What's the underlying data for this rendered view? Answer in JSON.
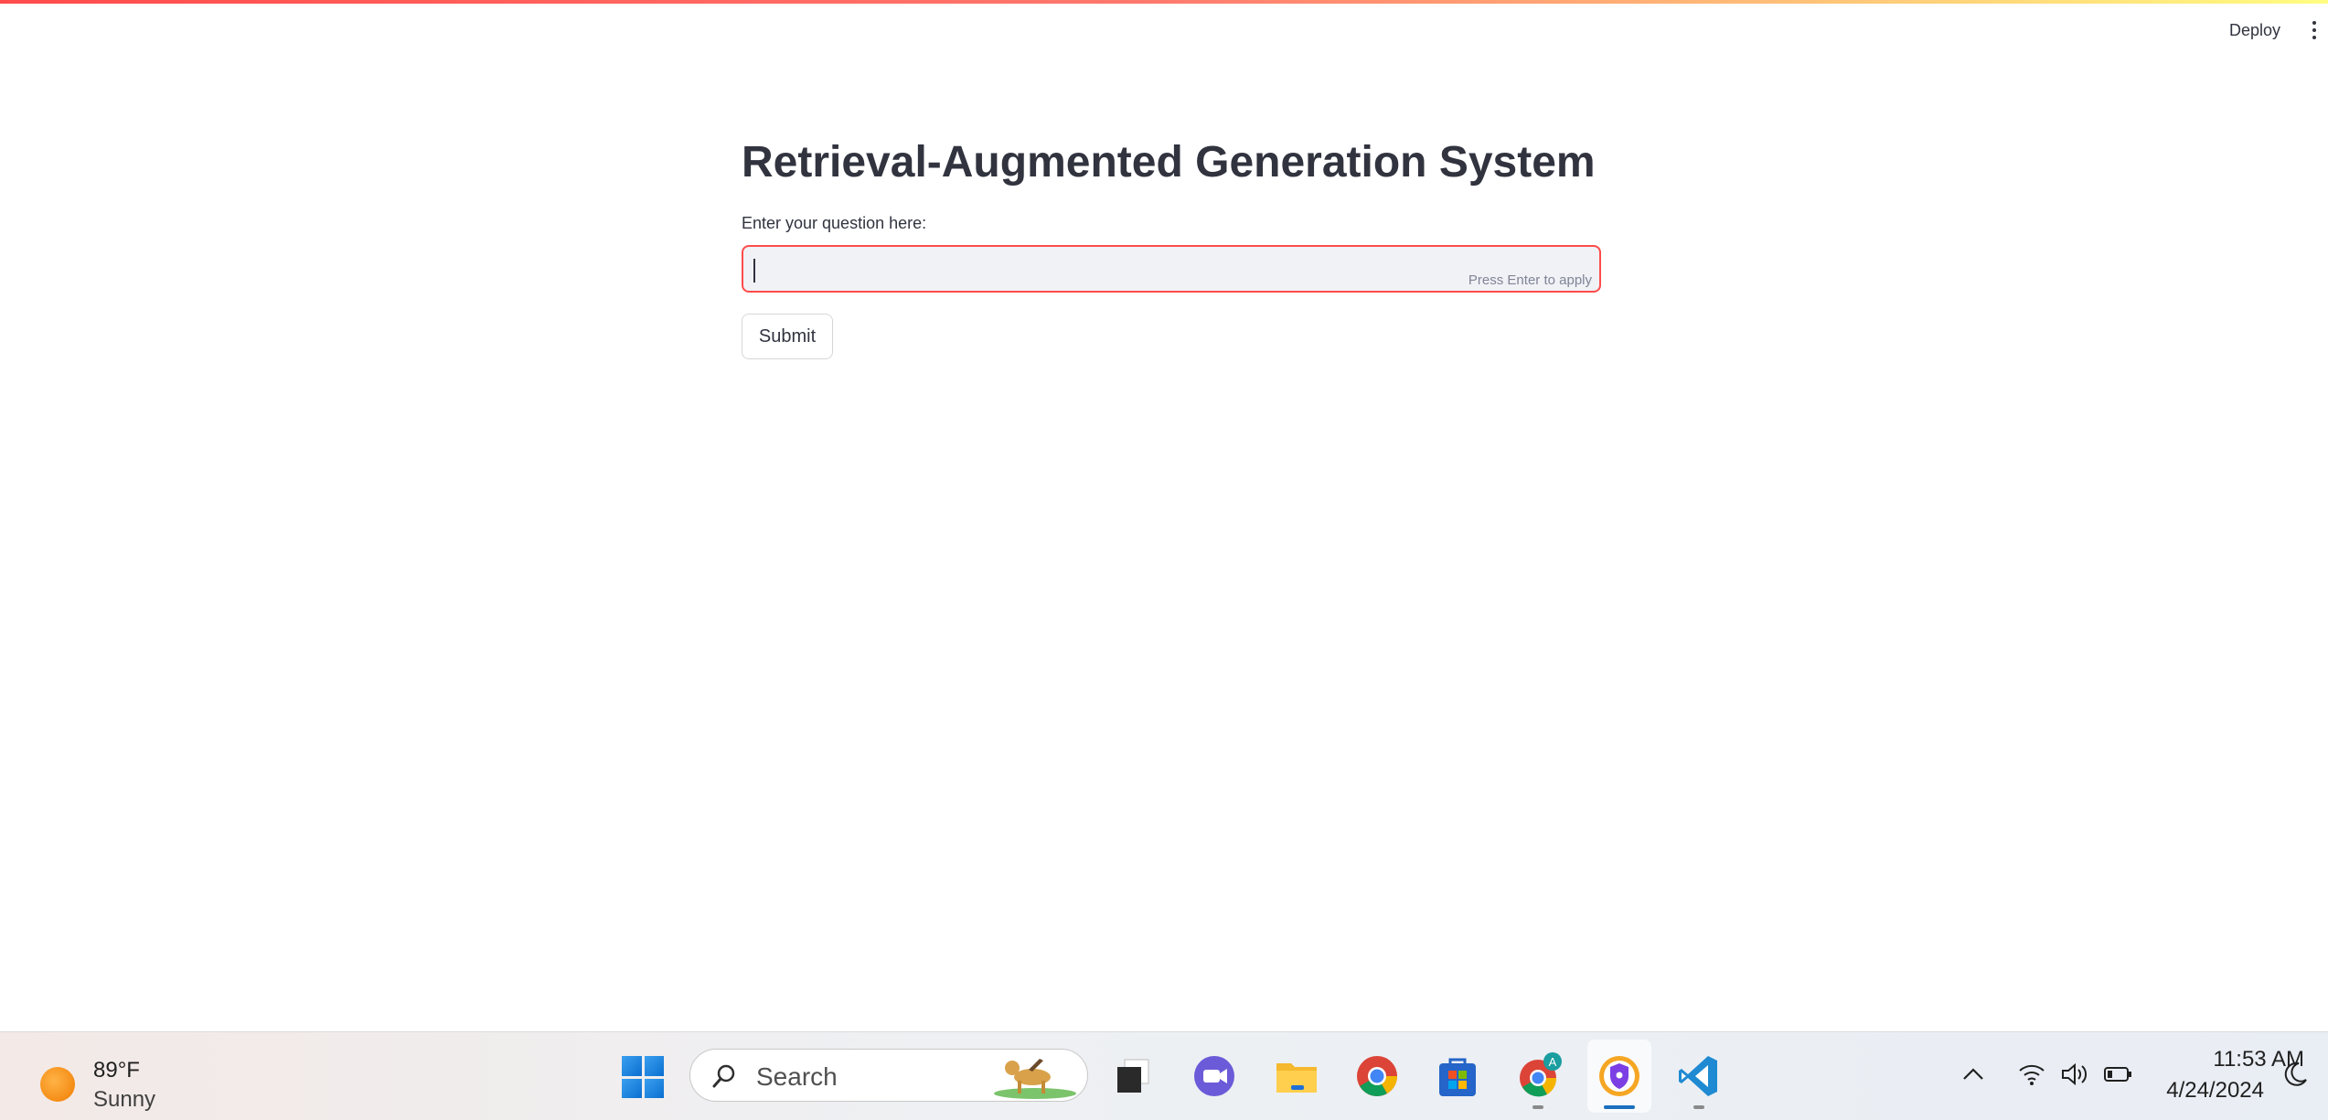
{
  "app": {
    "deploy_label": "Deploy",
    "title": "Retrieval-Augmented Generation System",
    "question_label": "Enter your question here:",
    "question_value": "",
    "question_hint": "Press Enter to apply",
    "submit_label": "Submit",
    "accent_color": "#ff4b4b"
  },
  "taskbar": {
    "weather": {
      "temperature": "89°F",
      "condition": "Sunny",
      "icon": "sun-icon"
    },
    "search": {
      "placeholder": "Search"
    },
    "apps": [
      {
        "name": "start",
        "icon": "windows-logo-icon"
      },
      {
        "name": "task-view",
        "icon": "task-view-icon"
      },
      {
        "name": "teams-meet",
        "icon": "video-call-icon"
      },
      {
        "name": "file-explorer",
        "icon": "folder-icon"
      },
      {
        "name": "chrome",
        "icon": "chrome-icon"
      },
      {
        "name": "microsoft-store",
        "icon": "store-icon"
      },
      {
        "name": "chrome-profile",
        "icon": "chrome-profile-icon",
        "badge": "A"
      },
      {
        "name": "vpn",
        "icon": "shield-lock-icon",
        "active": true
      },
      {
        "name": "vscode",
        "icon": "vscode-icon"
      }
    ],
    "tray": {
      "icons": [
        "chevron-up-icon",
        "wifi-icon",
        "volume-icon",
        "battery-icon",
        "moon-icon"
      ],
      "time": "11:53 AM",
      "date": "4/24/2024"
    }
  }
}
